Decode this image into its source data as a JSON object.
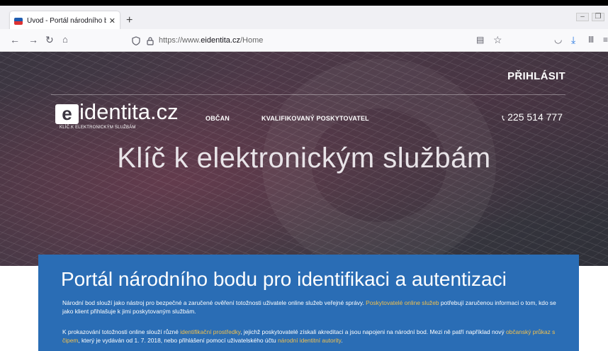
{
  "browser": {
    "tab_title": "Úvod - Portál národního bodu",
    "tab_close": "✕",
    "new_tab": "+",
    "url_prefix": "https://www.",
    "url_domain": "eidentita.cz",
    "url_path": "/Home",
    "icons": [
      "back-icon",
      "forward-icon",
      "reload-icon",
      "home-icon",
      "shield-icon",
      "lock-icon",
      "reader-icon",
      "bookmark-star-icon",
      "pocket-icon",
      "download-icon",
      "library-icon",
      "menu-icon",
      "minimize-icon",
      "restore-icon"
    ]
  },
  "site": {
    "login": "PŘIHLÁSIT",
    "logo_badge": "e",
    "logo_text": "identita.cz",
    "logo_sub": "KLÍČ K ELEKTRONICKÝM SLUŽBÁM",
    "menu": [
      "OBČAN",
      "KVALIFIKOVANÝ POSKYTOVATEL"
    ],
    "phone": "225 514 777",
    "hero_title": "Klíč k elektronickým službám"
  },
  "panel": {
    "title": "Portál národního bodu pro identifikaci a autentizaci",
    "p1_a": "Národní bod slouží jako nástroj pro bezpečné a zaručené ověření totožnosti uživatele online služeb veřejné správy. ",
    "p1_link": "Poskytovatelé online služeb",
    "p1_b": " potřebují zaručenou informaci o tom, kdo se jako klient přihlašuje k jimi poskytovaným službám.",
    "p2_a": "K prokazování totožnosti online slouží různé ",
    "p2_link1": "identifikační prostředky",
    "p2_b": ", jejichž poskytovatelé získali akreditaci a jsou napojeni na národní bod. Mezi ně patří například nový ",
    "p2_link2": "občanský průkaz s čipem",
    "p2_c": ", který je vydáván od 1. 7. 2018, nebo přihlášení pomocí uživatelského účtu ",
    "p2_link3": "národní identitní autority",
    "p2_d": "."
  },
  "colors": {
    "panel": "#2a6db5",
    "link": "#f2c14e",
    "hero_dark": "#3a3540"
  }
}
